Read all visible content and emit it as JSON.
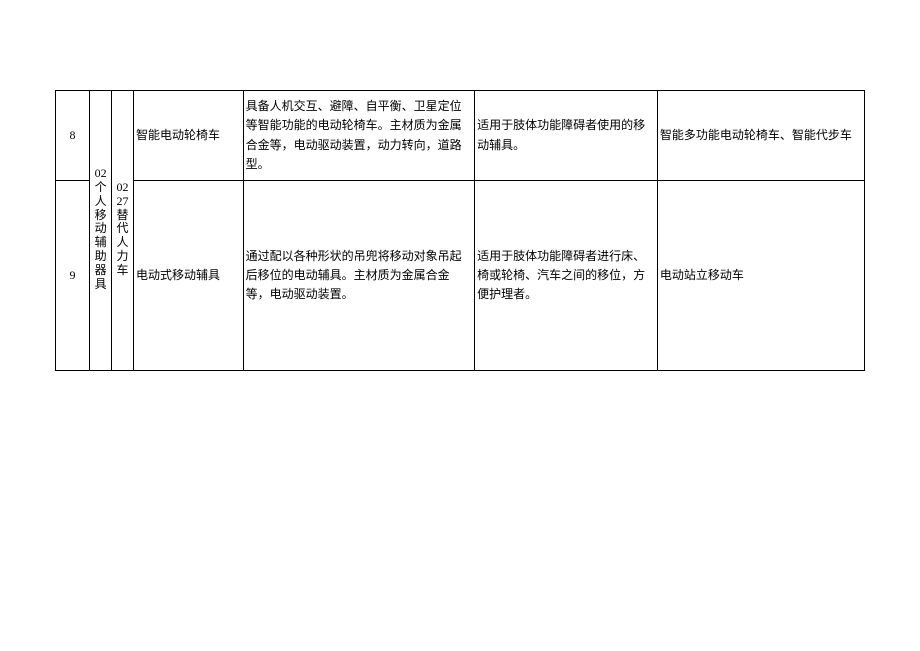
{
  "table": {
    "col2": "02个人移动辅助器具",
    "col3": "0227替代人力车",
    "rows": [
      {
        "num": "8",
        "c4": "智能电动轮椅车",
        "c5": "具备人机交互、避障、自平衡、卫星定位等智能功能的电动轮椅车。主材质为金属合金等，电动驱动装置，动力转向，道路型。",
        "c6": "适用于肢体功能障碍者使用的移动辅具。",
        "c7": "智能多功能电动轮椅车、智能代步车"
      },
      {
        "num": "9",
        "c4": "电动式移动辅具",
        "c5": "通过配以各种形状的吊兜将移动对象吊起后移位的电动辅具。主材质为金属合金等，电动驱动装置。",
        "c6": "适用于肢体功能障碍者进行床、椅或轮椅、汽车之间的移位，方便护理者。",
        "c7": "电动站立移动车"
      }
    ]
  }
}
